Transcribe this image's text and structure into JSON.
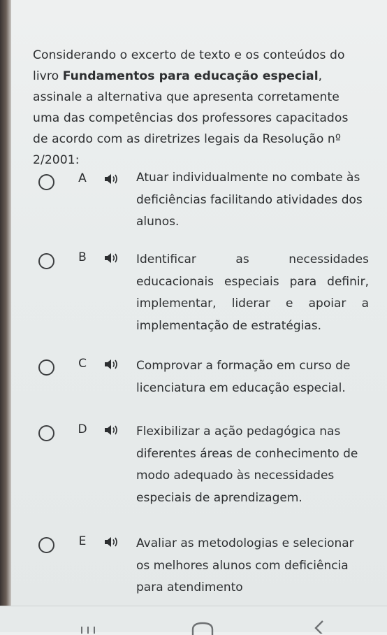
{
  "question": {
    "text_before": "Considerando o excerto de texto e os conteúdos do livro ",
    "bold": "Fundamentos para educação especial",
    "text_after": ", assinale a alternativa que apresenta corretamente uma das competências dos professores capacitados de acordo com as diretrizes legais da Resolução nº 2/2001:"
  },
  "options": [
    {
      "letter": "A",
      "text": "Atuar individualmente no combate às deficiências facilitando atividades dos alunos."
    },
    {
      "letter": "B",
      "text": "Identificar as necessidades educacionais especiais para definir, implementar, liderar e apoiar a implementação de estratégias."
    },
    {
      "letter": "C",
      "text": "Comprovar a formação em curso de licenciatura em educação especial."
    },
    {
      "letter": "D",
      "text": "Flexibilizar a ação pedagógica nas diferentes áreas de conhecimento de modo adequado às necessidades especiais de aprendizagem."
    },
    {
      "letter": "E",
      "text": "Avaliar as metodologias e selecionar os melhores alunos com deficiência para atendimento"
    }
  ],
  "icons": {
    "option_audio": "speaker-icon",
    "nav": [
      "recent-apps-icon",
      "home-icon",
      "back-icon"
    ]
  },
  "colors": {
    "text": "#2d2f31",
    "background": "#eef0f0",
    "radio_border": "#3d3f41"
  }
}
